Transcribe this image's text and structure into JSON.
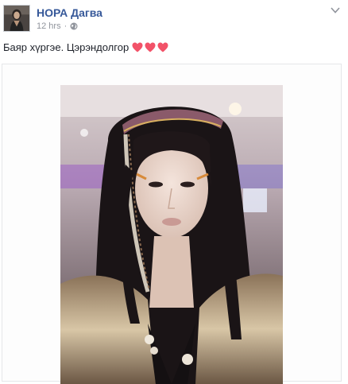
{
  "post": {
    "author": "НОРА Дагва",
    "time": "12 hrs",
    "separator": "·",
    "privacy_icon": "globe-icon",
    "menu_icon": "chevron-down-icon",
    "text": "Баяр хүргэе. Цэрэндолгор",
    "emoji": [
      "heart-icon",
      "heart-icon",
      "heart-icon"
    ],
    "photo_subject": "photo"
  },
  "colors": {
    "author_link": "#365899",
    "meta_gray": "#90949c",
    "text": "#1d2129",
    "heart": "#f25268",
    "border": "#e5e6e9"
  }
}
